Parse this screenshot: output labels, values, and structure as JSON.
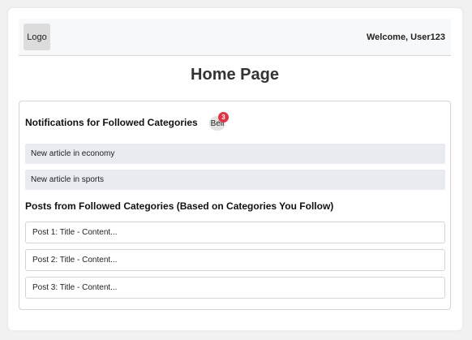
{
  "header": {
    "logo_label": "Logo",
    "welcome_text": "Welcome, User123"
  },
  "page_title": "Home Page",
  "notifications": {
    "title": "Notifications for Followed Categories",
    "bell_label": "Bell",
    "badge_count": "3",
    "items": [
      "New article in economy",
      "New article in sports"
    ]
  },
  "posts": {
    "title": "Posts from Followed Categories (Based on Categories You Follow)",
    "items": [
      "Post 1: Title - Content...",
      "Post 2: Title - Content...",
      "Post 3: Title - Content..."
    ]
  },
  "colors": {
    "badge": "#dc3545",
    "notification_bg": "#e8ebef",
    "header_bg": "#f7f8f9"
  }
}
